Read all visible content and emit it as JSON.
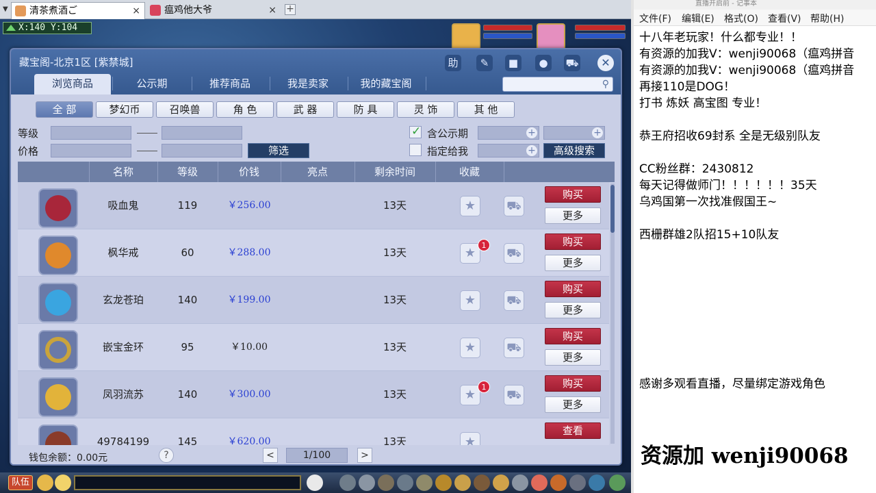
{
  "browser_tabs": [
    {
      "label": "清茶煮酒ご",
      "active": true
    },
    {
      "label": "瘟鸡他大爷",
      "active": false
    }
  ],
  "coords": "X:140 Y:104",
  "market": {
    "title": "藏宝阁-北京1区 [紫禁城]",
    "header_icons": [
      "help-icon",
      "pen-icon",
      "stop-icon",
      "chat-icon",
      "cart-icon"
    ],
    "header_help_label": "助",
    "tabs": [
      "浏览商品",
      "公示期",
      "推荐商品",
      "我是卖家",
      "我的藏宝阁"
    ],
    "categories": [
      "全 部",
      "梦幻币",
      "召唤兽",
      "角 色",
      "武 器",
      "防 具",
      "灵 饰",
      "其 他"
    ],
    "filter": {
      "level_label": "等级",
      "price_label": "价格",
      "filter_button": "筛选",
      "public_period_label": "含公示期",
      "public_period_checked": true,
      "assigned_label": "指定给我",
      "assigned_checked": false,
      "advanced_button": "高级搜索"
    },
    "columns": [
      "名称",
      "等级",
      "价钱",
      "亮点",
      "剩余时间",
      "收藏"
    ],
    "rows": [
      {
        "name": "吸血鬼",
        "level": "119",
        "price": "￥256.00",
        "price_blue": true,
        "time": "13天",
        "fav_badge": "",
        "action": "购买",
        "more": "更多",
        "icon_color": "#a8263a"
      },
      {
        "name": "枫华戒",
        "level": "60",
        "price": "￥288.00",
        "price_blue": true,
        "time": "13天",
        "fav_badge": "1",
        "action": "购买",
        "more": "更多",
        "icon_color": "#e0892c"
      },
      {
        "name": "玄龙苍珀",
        "level": "140",
        "price": "￥199.00",
        "price_blue": true,
        "time": "13天",
        "fav_badge": "",
        "action": "购买",
        "more": "更多",
        "icon_color": "#3aa5e0"
      },
      {
        "name": "嵌宝金环",
        "level": "95",
        "price": "￥10.00",
        "price_blue": false,
        "time": "13天",
        "fav_badge": "",
        "action": "购买",
        "more": "更多",
        "icon_color": "#c9a43c"
      },
      {
        "name": "凤羽流苏",
        "level": "140",
        "price": "￥300.00",
        "price_blue": true,
        "time": "13天",
        "fav_badge": "1",
        "action": "购买",
        "more": "更多",
        "icon_color": "#e2b33a"
      },
      {
        "name": "49784199",
        "level": "145",
        "price": "￥620.00",
        "price_blue": true,
        "time": "13天",
        "fav_badge": "",
        "action": "查看",
        "more": "",
        "icon_color": "#8a3b2a"
      }
    ],
    "wallet": "钱包余额：0.00元",
    "help": "?",
    "page": "1/100",
    "prev": "<",
    "next": ">"
  },
  "gamebar": {
    "team_label": "队伍"
  },
  "notepad": {
    "title": "直播开启前 - 记事本",
    "menu": [
      "文件(F)",
      "编辑(E)",
      "格式(O)",
      "查看(V)",
      "帮助(H)"
    ],
    "lines": [
      "十八年老玩家！什么都专业！！",
      "有资源的加我V：wenji90068（瘟鸡拼音",
      "有资源的加我V：wenji90068（瘟鸡拼音",
      "再接110是DOG！",
      "打书 炼妖 高宝图 专业！",
      "",
      "恭王府招收69封系 全是无级别队友",
      "",
      "CC粉丝群：2430812",
      "每天记得做师门！！！！！！35天",
      "乌鸡国第一次找准假国王~",
      "",
      "西栅群雄2队招15+10队友"
    ],
    "thanks_line": "感谢多观看直播，尽量绑定游戏角色",
    "big_text": "资源加 wenji90068"
  }
}
